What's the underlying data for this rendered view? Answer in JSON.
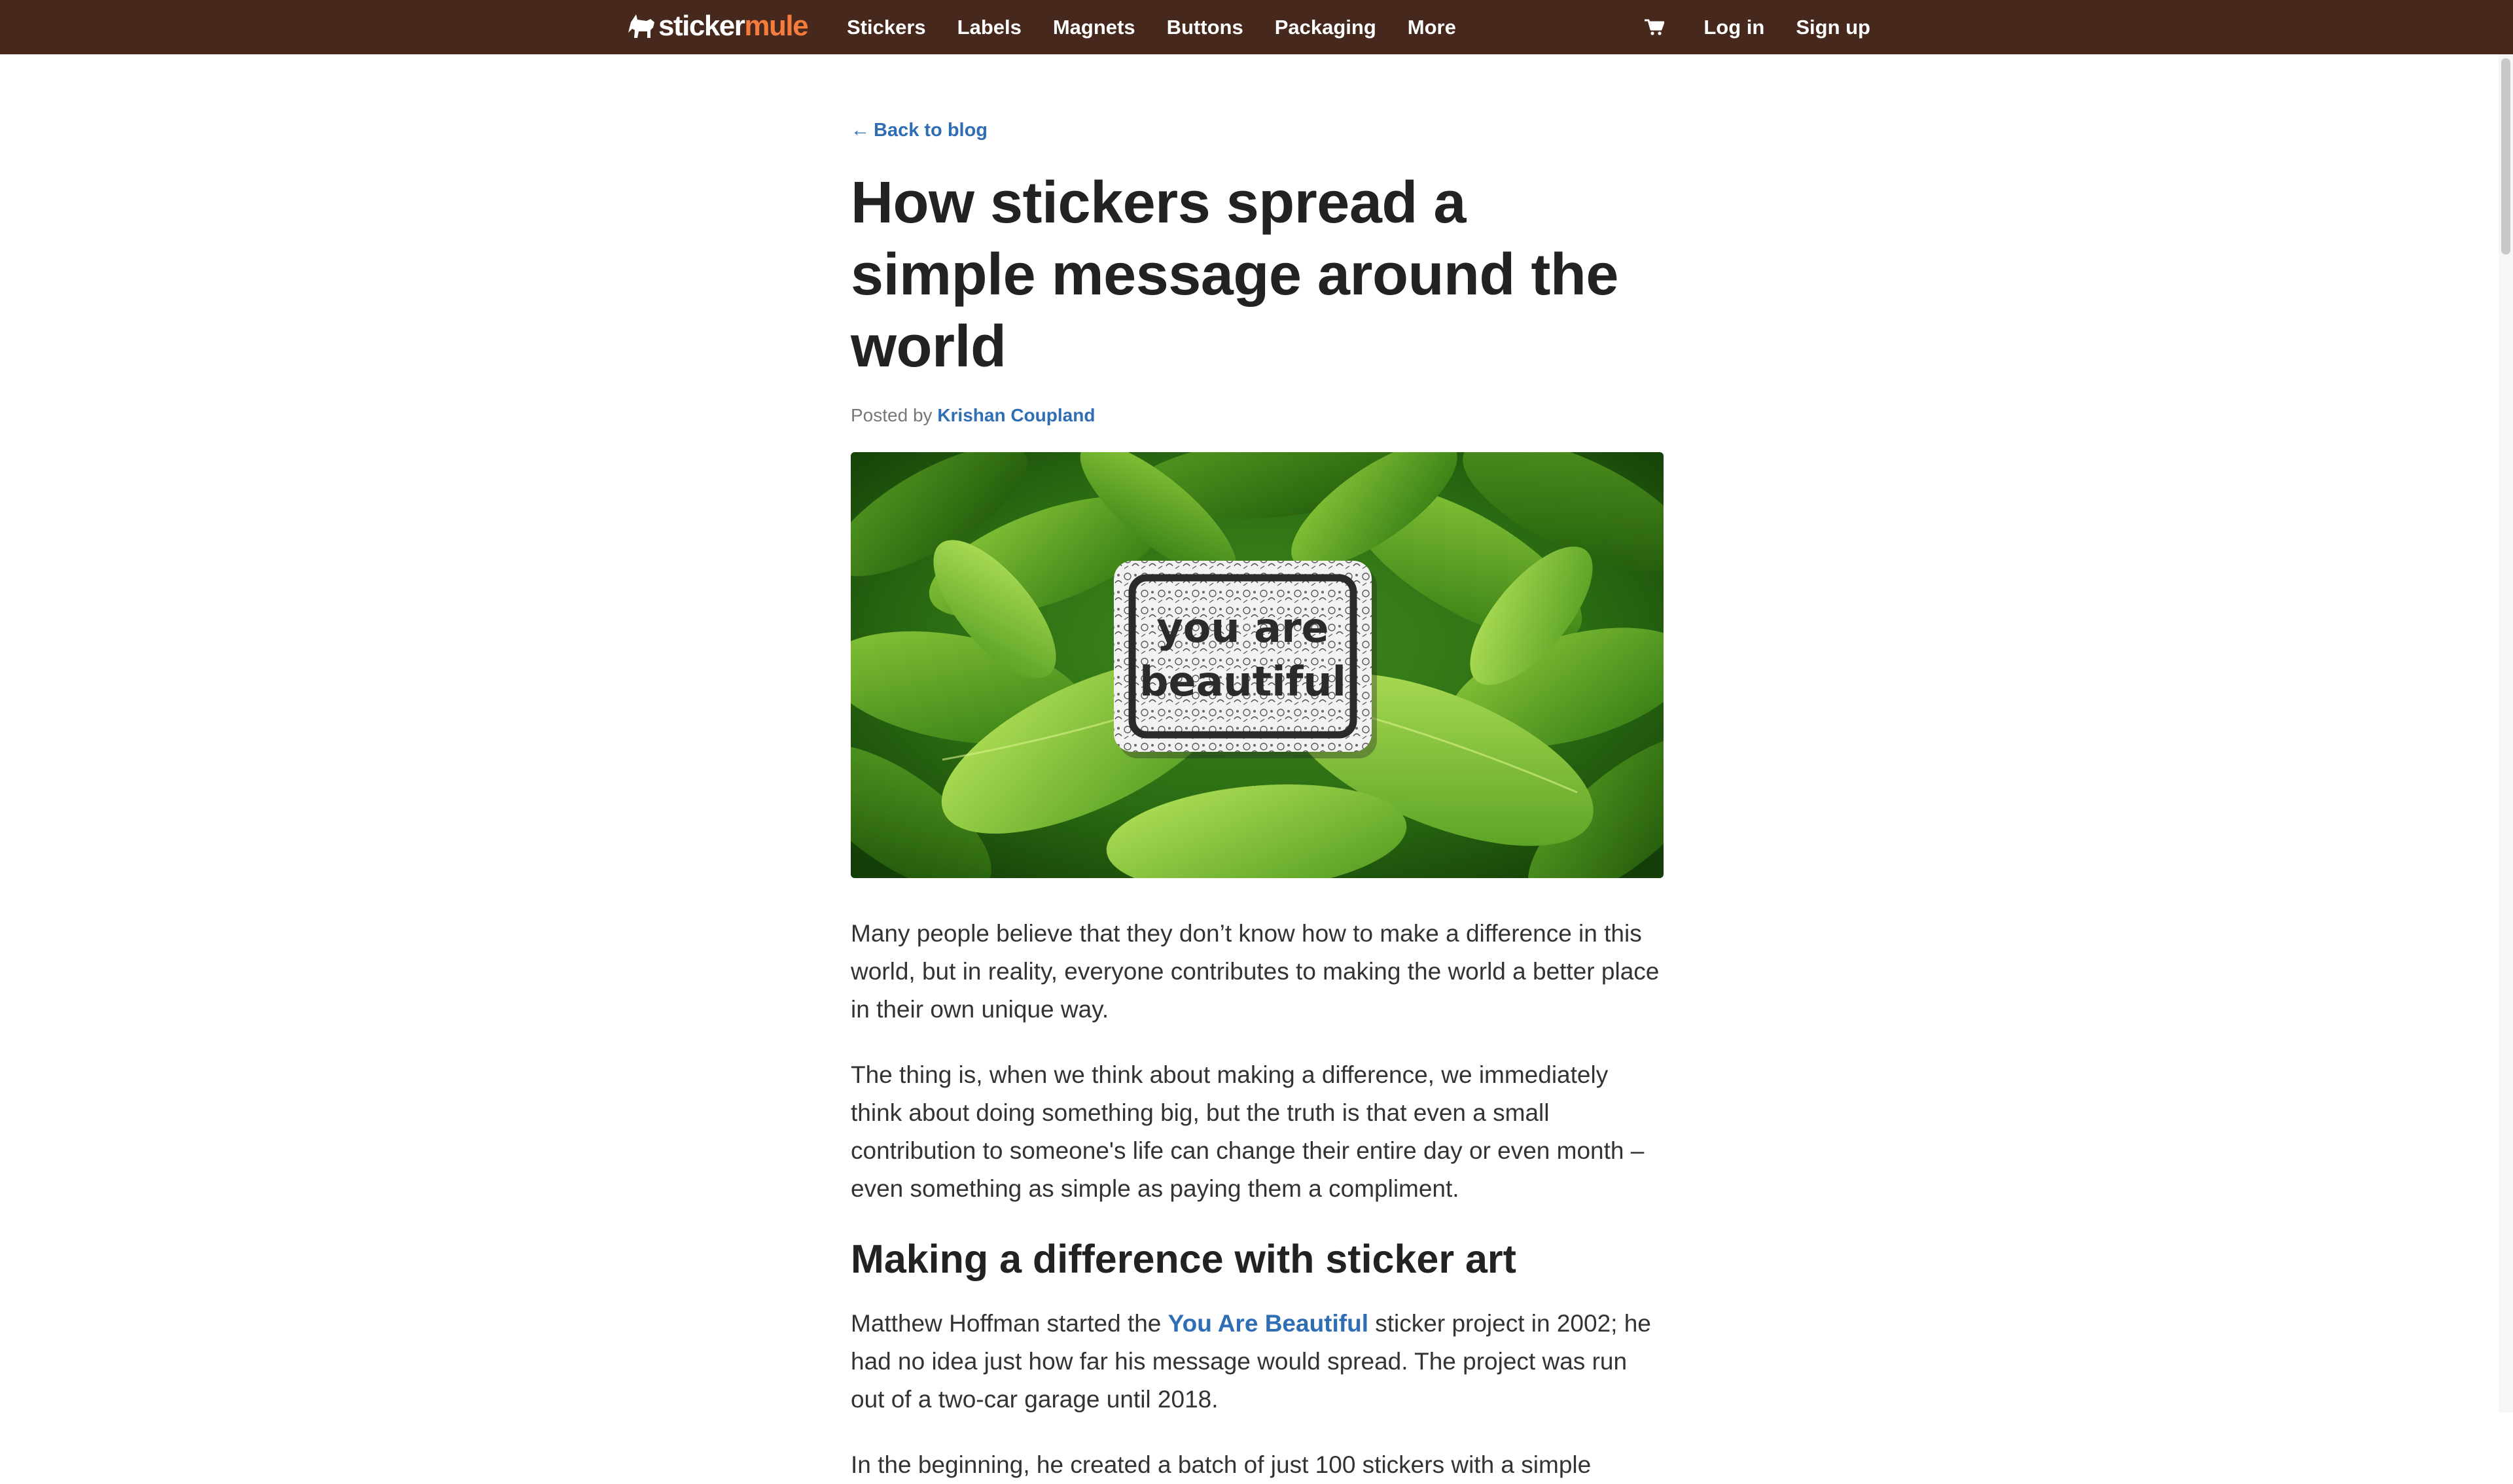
{
  "header": {
    "logo_part1": "sticker",
    "logo_part2": "mule",
    "nav": [
      "Stickers",
      "Labels",
      "Magnets",
      "Buttons",
      "Packaging",
      "More"
    ],
    "cart_icon": "cart-icon",
    "login_label": "Log in",
    "signup_label": "Sign up"
  },
  "article": {
    "back_arrow": "←",
    "back_label": "Back to blog",
    "title": "How stickers spread a simple message around the world",
    "byline_prefix": "Posted by",
    "author": "Krishan Coupland",
    "hero": {
      "sticker_line1": "you are",
      "sticker_line2": "beautiful"
    },
    "paragraphs": [
      "Many people believe that they don’t know how to make a difference in this world, but in reality, everyone contributes to making the world a better place in their own unique way.",
      "The thing is, when we think about making a difference, we immediately think about doing something big, but the truth is that even a small contribution to someone's life can change their entire day or even month – even something as simple as paying them a compliment."
    ],
    "section_heading": "Making a difference with sticker art",
    "section_para": {
      "before": "Matthew Hoffman started the ",
      "link": "You Are Beautiful",
      "after": " sticker project in 2002; he had no idea just how far his message would spread. The project was run out of a two-car garage until 2018."
    },
    "last_para": "In the beginning, he created a batch of just 100 stickers with a simple"
  },
  "colors": {
    "nav_background": "#46281c",
    "brand_orange": "#f47c3c",
    "link_blue": "#2f6db5"
  }
}
